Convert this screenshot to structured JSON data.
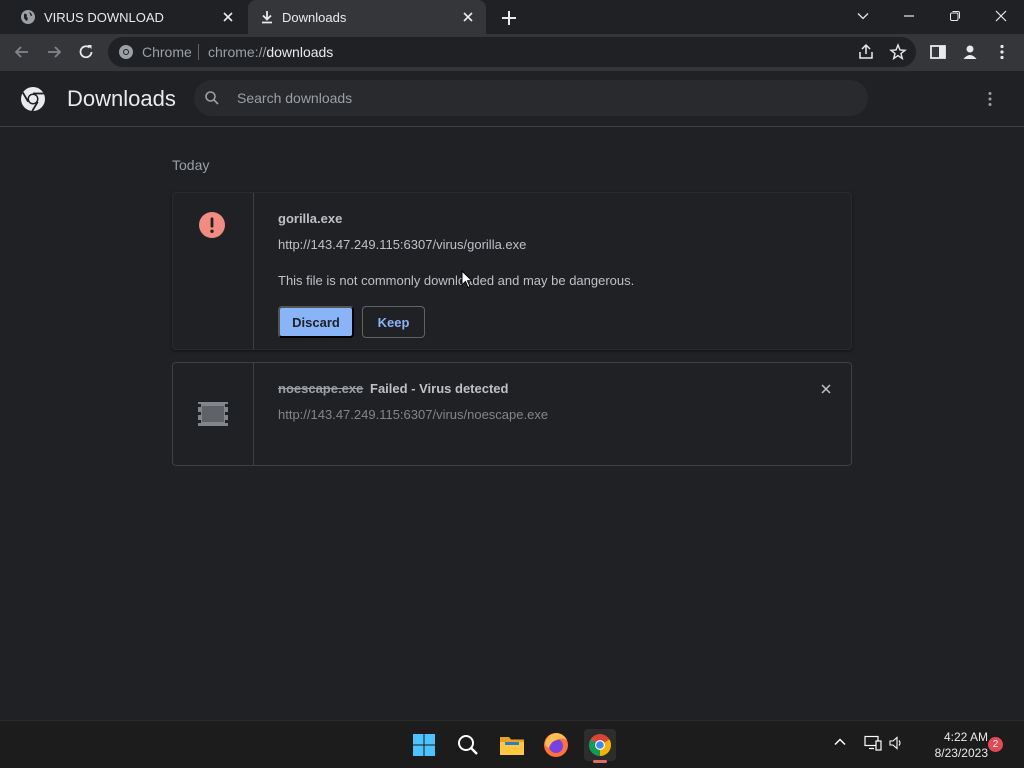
{
  "tabs": [
    {
      "title": "VIRUS DOWNLOAD",
      "icon": "globe-icon"
    },
    {
      "title": "Downloads",
      "icon": "download-icon",
      "active": true
    }
  ],
  "omnibox": {
    "chip": "Chrome",
    "url_prefix": "chrome://",
    "url_host": "downloads"
  },
  "header": {
    "title": "Downloads",
    "search_placeholder": "Search downloads"
  },
  "date_group": "Today",
  "downloads": [
    {
      "filename": "gorilla.exe",
      "url": "http://143.47.249.115:6307/virus/gorilla.exe",
      "warning": "This file is not commonly downloaded and may be dangerous.",
      "discard_label": "Discard",
      "keep_label": "Keep",
      "icon": "warning-icon"
    },
    {
      "filename": "noescape.exe",
      "status": "Failed - Virus detected",
      "url": "http://143.47.249.115:6307/virus/noescape.exe",
      "icon": "file-icon"
    }
  ],
  "taskbar": {
    "time": "4:22 AM",
    "date": "8/23/2023",
    "notification_count": "2"
  },
  "colors": {
    "accent": "#8ab4f8",
    "warning": "#f28b82",
    "background": "#202124"
  }
}
